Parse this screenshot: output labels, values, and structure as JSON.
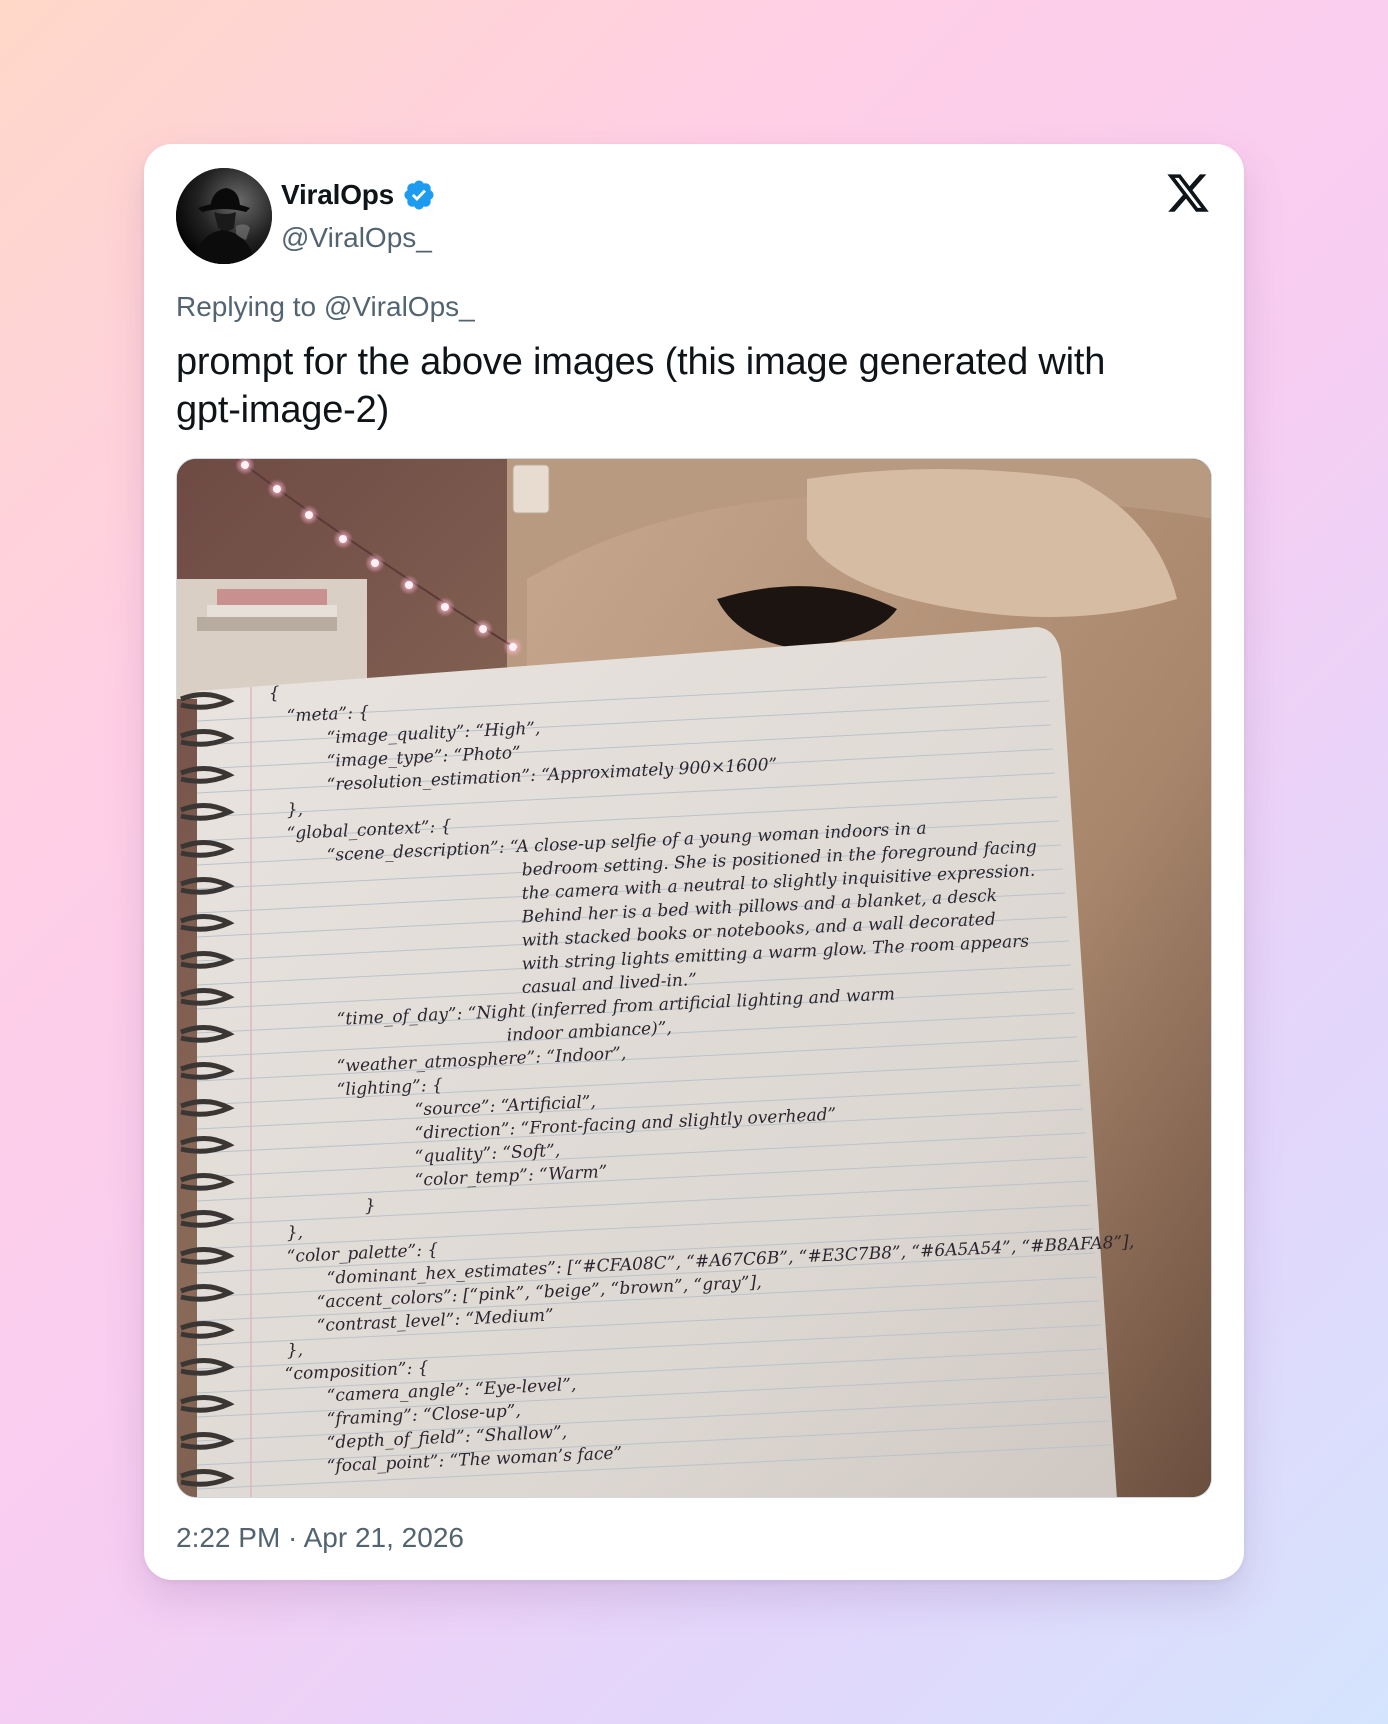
{
  "tweet": {
    "author": {
      "display_name": "ViralOps",
      "handle": "@ViralOps_",
      "verified": true,
      "avatar_icon": "avatar-silhouette-hat"
    },
    "platform_icon": "x-logo-icon",
    "replying_to_label": "Replying to",
    "replying_to_handle": "@ViralOps_",
    "text": "prompt for the above images (this image generated with gpt-image-2)",
    "timestamp": "2:22 PM · Apr 21, 2026",
    "media": {
      "description_icon": "notebook-photo",
      "notebook_lines": [
        "{",
        "“meta”: {",
        "“image_quality”: “High”,",
        "“image_type”: “Photo”",
        "“resolution_estimation”: “Approximately 900×1600”",
        "},",
        "“global_context”: {",
        "“scene_description”: “A close-up selfie of a young woman indoors in a",
        "bedroom setting. She is positioned in the foreground facing",
        "the camera with a neutral to slightly inquisitive expression.",
        "Behind her is a bed with pillows and a blanket, a desck",
        "with stacked books or notebooks, and a wall decorated",
        "with string lights emitting a warm glow. The room appears",
        "casual and lived-in.”",
        "“time_of_day”: “Night (inferred from artificial lighting and warm",
        "indoor ambiance)”,",
        "“weather_atmosphere”: “Indoor”,",
        "“lighting”: {",
        "“source”: “Artificial”,",
        "“direction”: “Front-facing and slightly overhead”",
        "“quality”: “Soft”,",
        "“color_temp”: “Warm”",
        "}",
        "},",
        "“color_palette”: {",
        "“dominant_hex_estimates”: [“#CFA08C”, “#A67C6B”, “#E3C7B8”, “#6A5A54”, “#B8AFA8”],",
        "“accent_colors”: [“pink”, “beige”, “brown”, “gray”],",
        "“contrast_level”: “Medium”",
        "},",
        "“composition”: {",
        "“camera_angle”: “Eye-level”,",
        "“framing”: “Close-up”,",
        "“depth_of_field”: “Shallow”,",
        "“focal_point”: “The woman’s face”"
      ]
    }
  },
  "colors": {
    "text_primary": "#0f1419",
    "text_secondary": "#536471",
    "verified_blue": "#1d9bf0",
    "card_bg": "#ffffff"
  }
}
